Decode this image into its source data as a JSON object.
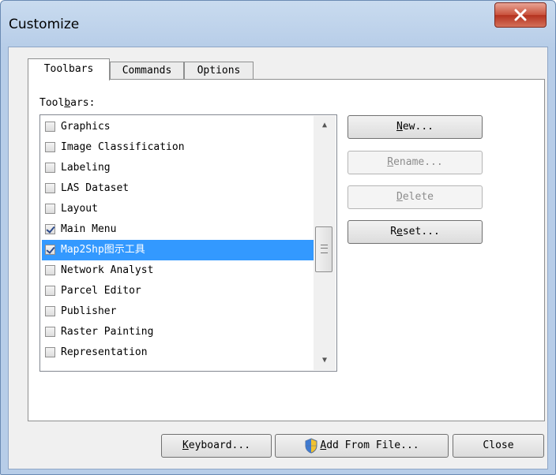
{
  "window": {
    "title": "Customize",
    "close_label": "X"
  },
  "tabs": [
    {
      "label": "Toolbars",
      "active": true
    },
    {
      "label": "Commands",
      "active": false
    },
    {
      "label": "Options",
      "active": false
    }
  ],
  "toolbars_label": "Toolbars:",
  "toolbar_list": [
    {
      "label": "Graphics",
      "checked": false
    },
    {
      "label": "Image Classification",
      "checked": false
    },
    {
      "label": "Labeling",
      "checked": false
    },
    {
      "label": "LAS Dataset",
      "checked": false
    },
    {
      "label": "Layout",
      "checked": false
    },
    {
      "label": "Main Menu",
      "checked": true
    },
    {
      "label": "Map2Shp图示工具",
      "checked": true,
      "selected": true
    },
    {
      "label": "Network Analyst",
      "checked": false
    },
    {
      "label": "Parcel Editor",
      "checked": false
    },
    {
      "label": "Publisher",
      "checked": false
    },
    {
      "label": "Raster Painting",
      "checked": false
    },
    {
      "label": "Representation",
      "checked": false
    }
  ],
  "side_buttons": {
    "new": "New...",
    "rename": "Rename...",
    "delete": "Delete",
    "reset": "Reset..."
  },
  "bottom_buttons": {
    "keyboard": "Keyboard...",
    "add_from_file": "Add From File...",
    "close": "Close"
  },
  "colors": {
    "selection": "#3399ff",
    "title_bar": "#b7cde8",
    "close_button": "#c9523c"
  }
}
